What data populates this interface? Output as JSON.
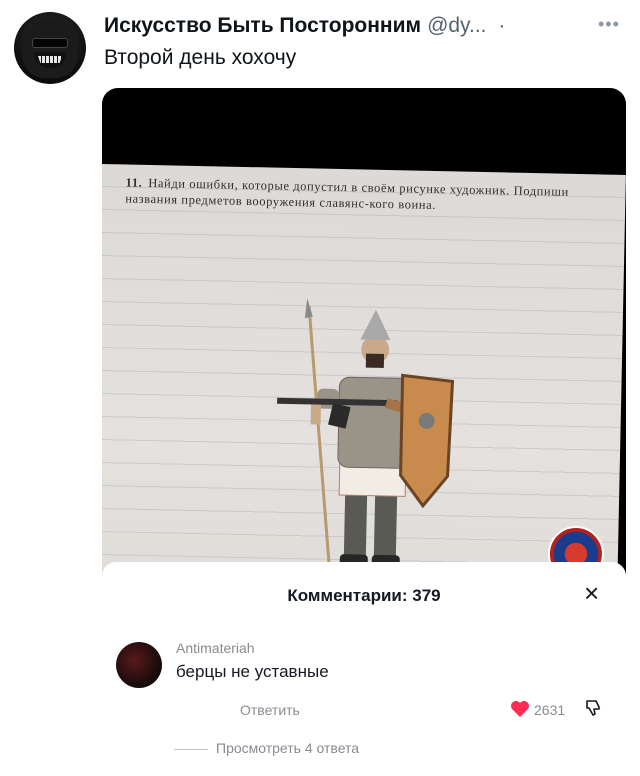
{
  "tweet": {
    "author_name": "Искусство Быть Посторонним",
    "author_handle": "@dy...",
    "separator": "·",
    "text": "Второй день хохочу",
    "more_icon": "more-horizontal-icon"
  },
  "media": {
    "exercise_number": "11.",
    "exercise_text": "Найди ошибки, которые допустил в своём рисунке художник. Подпиши названия предметов вооружения славянс-кого воина.",
    "colors": {
      "page": "#dfdcd8",
      "tiktok_red": "#fe2c55"
    },
    "tiktok_plus": "+",
    "icons": [
      "spear-icon",
      "shield-icon",
      "rifle-icon",
      "heart-icon"
    ]
  },
  "comments": {
    "title": "Комментарии: 379",
    "close_icon": "×",
    "items": [
      {
        "username": "Antimateriah",
        "text": "берцы не уставные",
        "reply_label": "Ответить",
        "likes": "2631",
        "view_replies": "Просмотреть 4 ответа"
      }
    ]
  }
}
